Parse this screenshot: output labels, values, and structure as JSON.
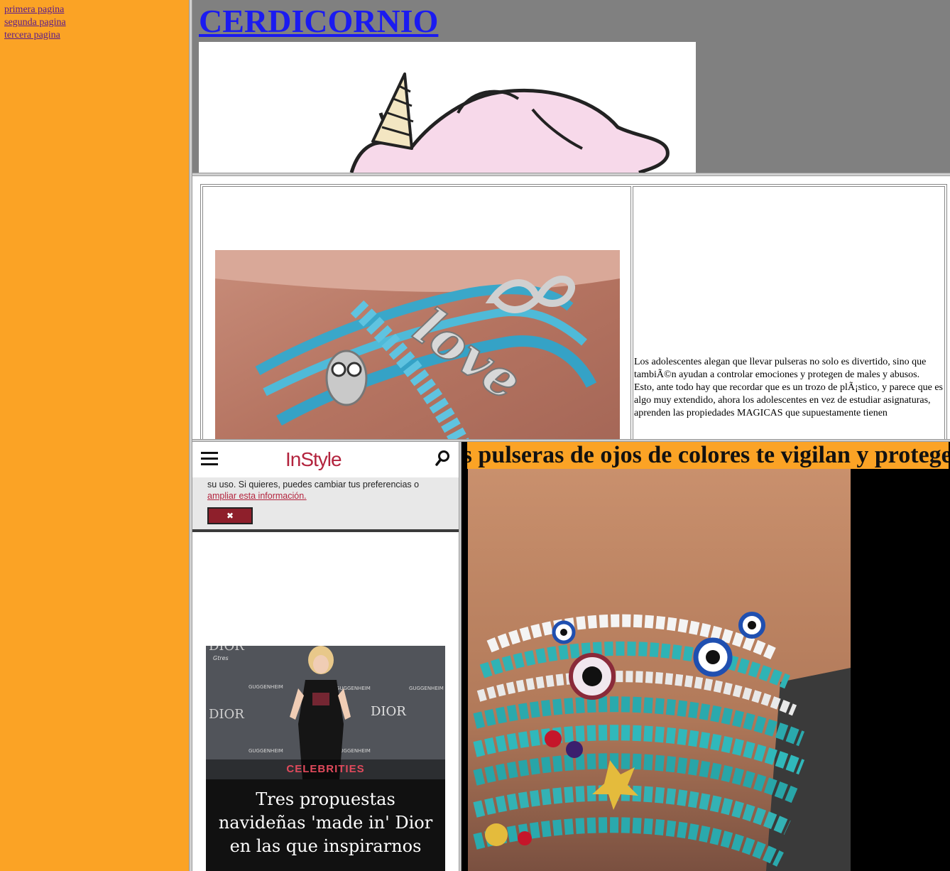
{
  "nav": {
    "links": [
      "primera pagina",
      "segunda pagina",
      "tercera pagina"
    ]
  },
  "header": {
    "title": "CERDICORNIO"
  },
  "article": {
    "paragraph1": "Los adolescentes alegan que llevar pulseras no solo es divertido, sino que tambiÃ©n ayudan a controlar emociones y protegen de males y abusos.",
    "paragraph2": "Esto, ante todo hay que recordar que es un trozo de plÃ¡stico, y parece que es algo muy extendido, ahora los adolescentes en vez de estudiar asignaturas, aprenden las propiedades MAGICAS que supuestamente tienen"
  },
  "instyle": {
    "logo": "InStyle",
    "cookie_text": "su uso. Si quieres, puedes cambiar tus preferencias o ",
    "cookie_link": "ampliar esta información.",
    "close_symbol": "✖",
    "promo_category": "CELEBRITIES",
    "promo_title": "Tres propuestas navideñas 'made in' Dior en las que inspirarnos",
    "promo_photo_texts": [
      "DIOR",
      "Gtres",
      "GUGGENHEIM",
      "DIOR"
    ]
  },
  "marquee": {
    "text": "Las pulseras de ojos de colores te vigilan y protegen"
  },
  "colors": {
    "nav_bg": "#fba325",
    "header_bg": "#808080",
    "link": "#1b1bf0",
    "brand": "#b3243e"
  }
}
